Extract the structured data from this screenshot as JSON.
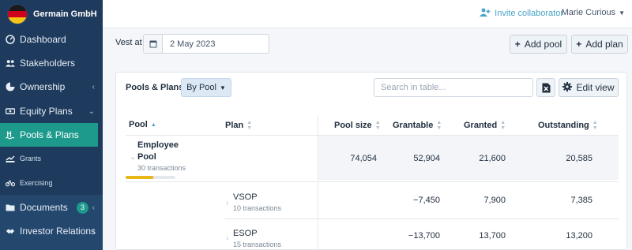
{
  "company": {
    "name": "Germain GmbH",
    "flag_colors": [
      "#1a1a1a",
      "#d0021b",
      "#f5c518"
    ]
  },
  "sidebar": {
    "items": [
      {
        "label": "Dashboard",
        "icon": "dashboard-icon"
      },
      {
        "label": "Stakeholders",
        "icon": "users-icon"
      },
      {
        "label": "Ownership",
        "icon": "pie-chart-icon",
        "chevron": "‹"
      },
      {
        "label": "Equity Plans",
        "icon": "money-icon",
        "chevron": "⌄"
      },
      {
        "label": "Pools & Plans",
        "icon": "pool-icon",
        "active": true
      },
      {
        "label": "Grants",
        "icon": "grant-icon"
      },
      {
        "label": "Exercising",
        "icon": "bike-icon"
      },
      {
        "label": "Documents",
        "icon": "folder-icon",
        "badge": "3",
        "chevron": "‹"
      },
      {
        "label": "Investor Relations",
        "icon": "handshake-icon",
        "chevron": "‹"
      }
    ]
  },
  "topbar": {
    "invite_label": "Invite collaborator",
    "user_name": "Marie Curious"
  },
  "vest": {
    "label": "Vest at",
    "date": "2 May 2023"
  },
  "actions": {
    "add_pool": "Add pool",
    "add_plan": "Add plan"
  },
  "card": {
    "title": "Pools & Plans",
    "group_by": "By Pool",
    "search_placeholder": "Search in table...",
    "edit_view": "Edit view"
  },
  "table": {
    "headers": [
      "Pool",
      "Plan",
      "Pool size",
      "Grantable",
      "Granted",
      "Outstanding"
    ],
    "pool_row": {
      "pool_line1": "Employee",
      "pool_line2": "Pool",
      "transactions": "30 transactions",
      "progress": 0.55,
      "pool_size": "74,054",
      "grantable": "52,904",
      "granted": "21,600",
      "outstanding": "20,585"
    },
    "plan_rows": [
      {
        "plan": "VSOP",
        "transactions": "10 transactions",
        "grantable": "−7,450",
        "granted": "7,900",
        "outstanding": "7,385"
      },
      {
        "plan": "ESOP",
        "transactions": "15 transactions",
        "grantable": "−13,700",
        "granted": "13,700",
        "outstanding": "13,200"
      }
    ]
  },
  "colors": {
    "sidebar": "#1e3a5c",
    "active": "#1d9a8c",
    "accent": "#4aa3c8",
    "progress": "#e8b81b"
  }
}
